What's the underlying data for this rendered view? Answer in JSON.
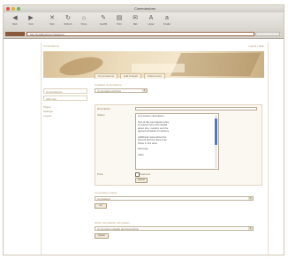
{
  "window": {
    "title": "Commissions"
  },
  "colors": {
    "accent": "#8a5a3c",
    "banner": "#d8c29a",
    "scroll_thumb": "#4b78c8"
  },
  "toolbar": {
    "items": [
      {
        "icon": "back-icon",
        "label": "Back"
      },
      {
        "icon": "forward-icon",
        "label": "Fwd"
      },
      {
        "icon": "stop-icon",
        "label": "Stop"
      },
      {
        "icon": "reload-icon",
        "label": "Refresh"
      },
      {
        "icon": "home-icon",
        "label": "Home"
      },
      {
        "icon": "autofill-icon",
        "label": "AutoFill"
      },
      {
        "icon": "print-icon",
        "label": "Print"
      },
      {
        "icon": "mail-icon",
        "label": "Mail"
      },
      {
        "icon": "larger-icon",
        "label": "Larger"
      },
      {
        "icon": "smaller-icon",
        "label": "Smaller"
      }
    ]
  },
  "address": {
    "url": "http://localhost/commissions/..."
  },
  "page": {
    "site_title": "Commissions",
    "site_links": "Logout | Help",
    "tabs": [
      "Commissions",
      "Add Artwork",
      "Preferences"
    ]
  },
  "sidebar": {
    "heading": "Commissions",
    "box1": "Commissions",
    "box2": "Add new",
    "links": [
      "Pages",
      "Settings",
      "Logout"
    ]
  },
  "main": {
    "section1_label": "Available Commissions",
    "section1_select": "Commission Archive",
    "form": {
      "row1_label": "Description",
      "row2_label": "Status",
      "row3_label": "Price",
      "textarea_lines": [
        "Commission description",
        "",
        "Text of the commission entry",
        "is entered here with details",
        "about size, medium and the",
        "agreed schedule for delivery.",
        "",
        "Additional notes about the",
        "artwork and the client may",
        "follow in this area.",
        "",
        "Sincerely,",
        "",
        "Artist"
      ],
      "checkbox_label": "Featured",
      "submit_label": "Submit"
    },
    "section2_label": "Commission status",
    "section2_select": "Completed",
    "section2_button": "Go",
    "section3_label": "Other commission information",
    "section3_select": "Commission details and description",
    "section3_button": "Update"
  }
}
